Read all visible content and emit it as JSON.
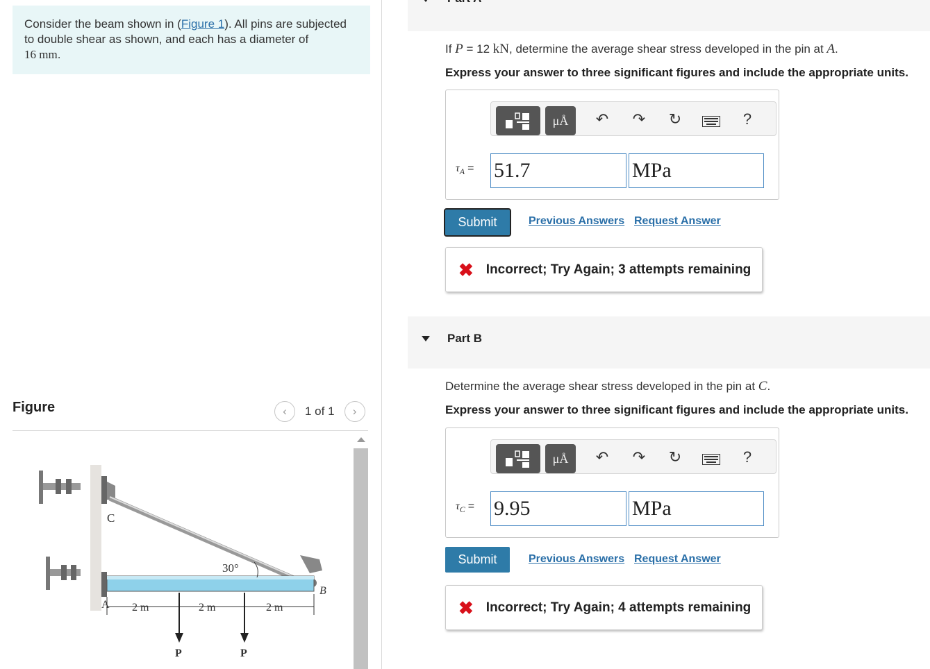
{
  "intro": {
    "text_before": "Consider the beam shown in (",
    "figure_link": "Figure 1",
    "text_after": "). All pins are subjected to double shear as shown, and each has a diameter of",
    "diameter": "16 mm",
    "period": "."
  },
  "figure": {
    "title": "Figure",
    "pager": "1 of 1",
    "prev_icon": "chevron-left-icon",
    "next_icon": "chevron-right-icon",
    "labels": {
      "c": "C",
      "a": "A",
      "b": "B",
      "angle": "30°",
      "dim1": "2 m",
      "dim2": "2 m",
      "dim3": "2 m",
      "p1": "P",
      "p2": "P"
    }
  },
  "part_a": {
    "label": "Part A",
    "question_prefix": "If ",
    "question_var": "P",
    "question_mid": " = 12 ",
    "question_unit": "kN",
    "question_suffix": ", determine the average shear stress developed in the pin at ",
    "question_point": "A",
    "question_end": ".",
    "instruction": "Express your answer to three significant figures and include the appropriate units.",
    "var_symbol": "τ",
    "var_sub": "A",
    "equals": "=",
    "value": "51.7",
    "unit": "MPa",
    "submit": "Submit",
    "previous_answers": "Previous Answers",
    "request_answer": "Request Answer",
    "feedback": "Incorrect; Try Again; 3 attempts remaining"
  },
  "part_b": {
    "label": "Part B",
    "question_prefix": "Determine the average shear stress developed in the pin at ",
    "question_point": "C",
    "question_end": ".",
    "instruction": "Express your answer to three significant figures and include the appropriate units.",
    "var_symbol": "τ",
    "var_sub": "C",
    "equals": "=",
    "value": "9.95",
    "unit": "MPa",
    "submit": "Submit",
    "previous_answers": "Previous Answers",
    "request_answer": "Request Answer",
    "feedback": "Incorrect; Try Again; 4 attempts remaining"
  },
  "toolbar": {
    "units_btn": "μÅ",
    "undo": "↶",
    "redo": "↷",
    "reset": "↻",
    "help": "?"
  },
  "colors": {
    "accent": "#2e7ba8",
    "intro_bg": "#e8f6f7",
    "error": "#d8101a",
    "beam": "#8ed1ea"
  }
}
